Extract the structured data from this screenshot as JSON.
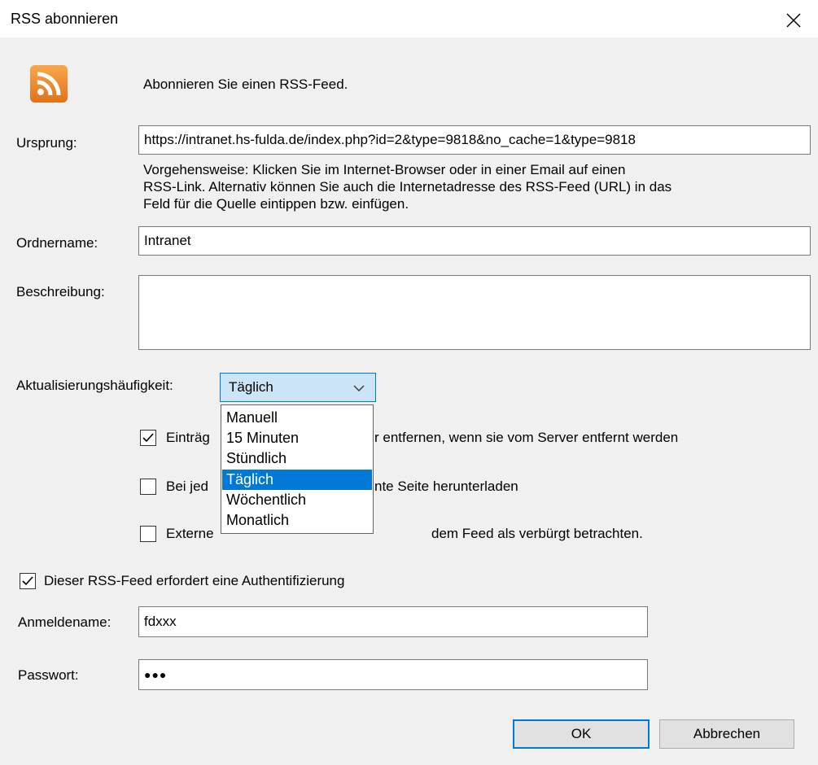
{
  "window": {
    "title": "RSS abonnieren",
    "close_icon": "close-icon"
  },
  "header": {
    "icon": "rss-feed-icon",
    "icon_color": "#ee8a22",
    "intro": "Abonnieren Sie einen RSS-Feed."
  },
  "form": {
    "origin_label": "Ursprung:",
    "origin_value": "https://intranet.hs-fulda.de/index.php?id=2&type=9818&no_cache=1&type=9818",
    "help_lines": [
      "Vorgehensweise: Klicken Sie im Internet-Browser oder in einer Email auf einen",
      "RSS-Link. Alternativ können Sie auch die Internetadresse des RSS-Feed (URL) in das",
      "Feld für die Quelle eintippen bzw. einfügen."
    ],
    "folder_label": "Ordnername:",
    "folder_value": "Intranet",
    "description_label": "Beschreibung:",
    "description_value": "",
    "frequency_label": "Aktualisierungshäufigkeit:",
    "frequency_selected": "Täglich",
    "frequency_options": [
      "Manuell",
      "15 Minuten",
      "Stündlich",
      "Täglich",
      "Wöchentlich",
      "Monatlich"
    ],
    "options": [
      {
        "visible_label": "Einträg",
        "trailing_label": "r entfernen, wenn sie vom Server entfernt werden",
        "checked": true
      },
      {
        "visible_label": "Bei jed",
        "trailing_label": "nte Seite herunterladen",
        "checked": false
      },
      {
        "visible_label": "Externe",
        "trailing_label": "dem Feed als verbürgt betrachten.",
        "checked": false
      }
    ],
    "auth_label": "Dieser RSS-Feed erfordert eine Authentifizierung",
    "auth_checked": true,
    "login_label": "Anmeldename:",
    "login_value": "fdxxx",
    "password_label": "Passwort:",
    "password_value": "●●●"
  },
  "buttons": {
    "ok": "OK",
    "cancel": "Abbrechen"
  },
  "colors": {
    "accent": "#0078d7",
    "selection": "#0078d7",
    "combo_background": "#cce4f7"
  }
}
